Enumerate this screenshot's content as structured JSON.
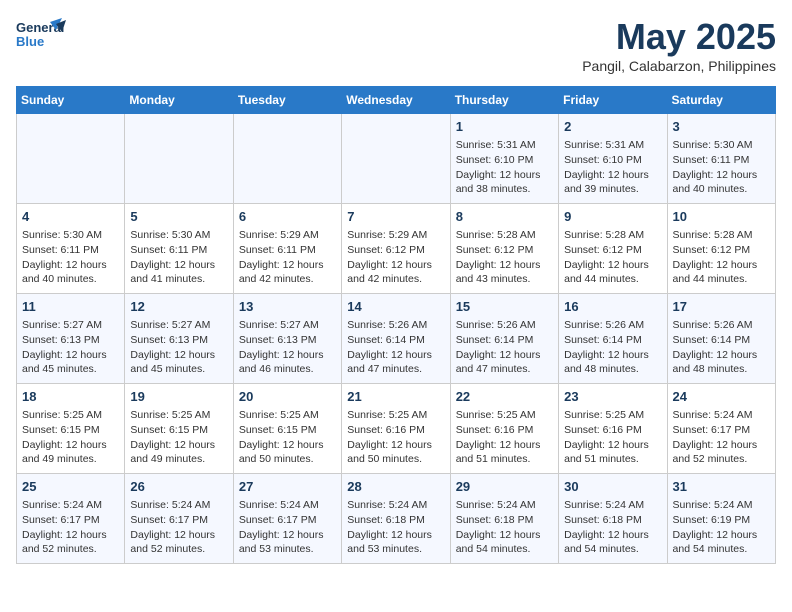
{
  "header": {
    "logo_general": "General",
    "logo_blue": "Blue",
    "month": "May 2025",
    "location": "Pangil, Calabarzon, Philippines"
  },
  "days_of_week": [
    "Sunday",
    "Monday",
    "Tuesday",
    "Wednesday",
    "Thursday",
    "Friday",
    "Saturday"
  ],
  "weeks": [
    [
      {
        "day": "",
        "info": ""
      },
      {
        "day": "",
        "info": ""
      },
      {
        "day": "",
        "info": ""
      },
      {
        "day": "",
        "info": ""
      },
      {
        "day": "1",
        "info": "Sunrise: 5:31 AM\nSunset: 6:10 PM\nDaylight: 12 hours\nand 38 minutes."
      },
      {
        "day": "2",
        "info": "Sunrise: 5:31 AM\nSunset: 6:10 PM\nDaylight: 12 hours\nand 39 minutes."
      },
      {
        "day": "3",
        "info": "Sunrise: 5:30 AM\nSunset: 6:11 PM\nDaylight: 12 hours\nand 40 minutes."
      }
    ],
    [
      {
        "day": "4",
        "info": "Sunrise: 5:30 AM\nSunset: 6:11 PM\nDaylight: 12 hours\nand 40 minutes."
      },
      {
        "day": "5",
        "info": "Sunrise: 5:30 AM\nSunset: 6:11 PM\nDaylight: 12 hours\nand 41 minutes."
      },
      {
        "day": "6",
        "info": "Sunrise: 5:29 AM\nSunset: 6:11 PM\nDaylight: 12 hours\nand 42 minutes."
      },
      {
        "day": "7",
        "info": "Sunrise: 5:29 AM\nSunset: 6:12 PM\nDaylight: 12 hours\nand 42 minutes."
      },
      {
        "day": "8",
        "info": "Sunrise: 5:28 AM\nSunset: 6:12 PM\nDaylight: 12 hours\nand 43 minutes."
      },
      {
        "day": "9",
        "info": "Sunrise: 5:28 AM\nSunset: 6:12 PM\nDaylight: 12 hours\nand 44 minutes."
      },
      {
        "day": "10",
        "info": "Sunrise: 5:28 AM\nSunset: 6:12 PM\nDaylight: 12 hours\nand 44 minutes."
      }
    ],
    [
      {
        "day": "11",
        "info": "Sunrise: 5:27 AM\nSunset: 6:13 PM\nDaylight: 12 hours\nand 45 minutes."
      },
      {
        "day": "12",
        "info": "Sunrise: 5:27 AM\nSunset: 6:13 PM\nDaylight: 12 hours\nand 45 minutes."
      },
      {
        "day": "13",
        "info": "Sunrise: 5:27 AM\nSunset: 6:13 PM\nDaylight: 12 hours\nand 46 minutes."
      },
      {
        "day": "14",
        "info": "Sunrise: 5:26 AM\nSunset: 6:14 PM\nDaylight: 12 hours\nand 47 minutes."
      },
      {
        "day": "15",
        "info": "Sunrise: 5:26 AM\nSunset: 6:14 PM\nDaylight: 12 hours\nand 47 minutes."
      },
      {
        "day": "16",
        "info": "Sunrise: 5:26 AM\nSunset: 6:14 PM\nDaylight: 12 hours\nand 48 minutes."
      },
      {
        "day": "17",
        "info": "Sunrise: 5:26 AM\nSunset: 6:14 PM\nDaylight: 12 hours\nand 48 minutes."
      }
    ],
    [
      {
        "day": "18",
        "info": "Sunrise: 5:25 AM\nSunset: 6:15 PM\nDaylight: 12 hours\nand 49 minutes."
      },
      {
        "day": "19",
        "info": "Sunrise: 5:25 AM\nSunset: 6:15 PM\nDaylight: 12 hours\nand 49 minutes."
      },
      {
        "day": "20",
        "info": "Sunrise: 5:25 AM\nSunset: 6:15 PM\nDaylight: 12 hours\nand 50 minutes."
      },
      {
        "day": "21",
        "info": "Sunrise: 5:25 AM\nSunset: 6:16 PM\nDaylight: 12 hours\nand 50 minutes."
      },
      {
        "day": "22",
        "info": "Sunrise: 5:25 AM\nSunset: 6:16 PM\nDaylight: 12 hours\nand 51 minutes."
      },
      {
        "day": "23",
        "info": "Sunrise: 5:25 AM\nSunset: 6:16 PM\nDaylight: 12 hours\nand 51 minutes."
      },
      {
        "day": "24",
        "info": "Sunrise: 5:24 AM\nSunset: 6:17 PM\nDaylight: 12 hours\nand 52 minutes."
      }
    ],
    [
      {
        "day": "25",
        "info": "Sunrise: 5:24 AM\nSunset: 6:17 PM\nDaylight: 12 hours\nand 52 minutes."
      },
      {
        "day": "26",
        "info": "Sunrise: 5:24 AM\nSunset: 6:17 PM\nDaylight: 12 hours\nand 52 minutes."
      },
      {
        "day": "27",
        "info": "Sunrise: 5:24 AM\nSunset: 6:17 PM\nDaylight: 12 hours\nand 53 minutes."
      },
      {
        "day": "28",
        "info": "Sunrise: 5:24 AM\nSunset: 6:18 PM\nDaylight: 12 hours\nand 53 minutes."
      },
      {
        "day": "29",
        "info": "Sunrise: 5:24 AM\nSunset: 6:18 PM\nDaylight: 12 hours\nand 54 minutes."
      },
      {
        "day": "30",
        "info": "Sunrise: 5:24 AM\nSunset: 6:18 PM\nDaylight: 12 hours\nand 54 minutes."
      },
      {
        "day": "31",
        "info": "Sunrise: 5:24 AM\nSunset: 6:19 PM\nDaylight: 12 hours\nand 54 minutes."
      }
    ]
  ]
}
